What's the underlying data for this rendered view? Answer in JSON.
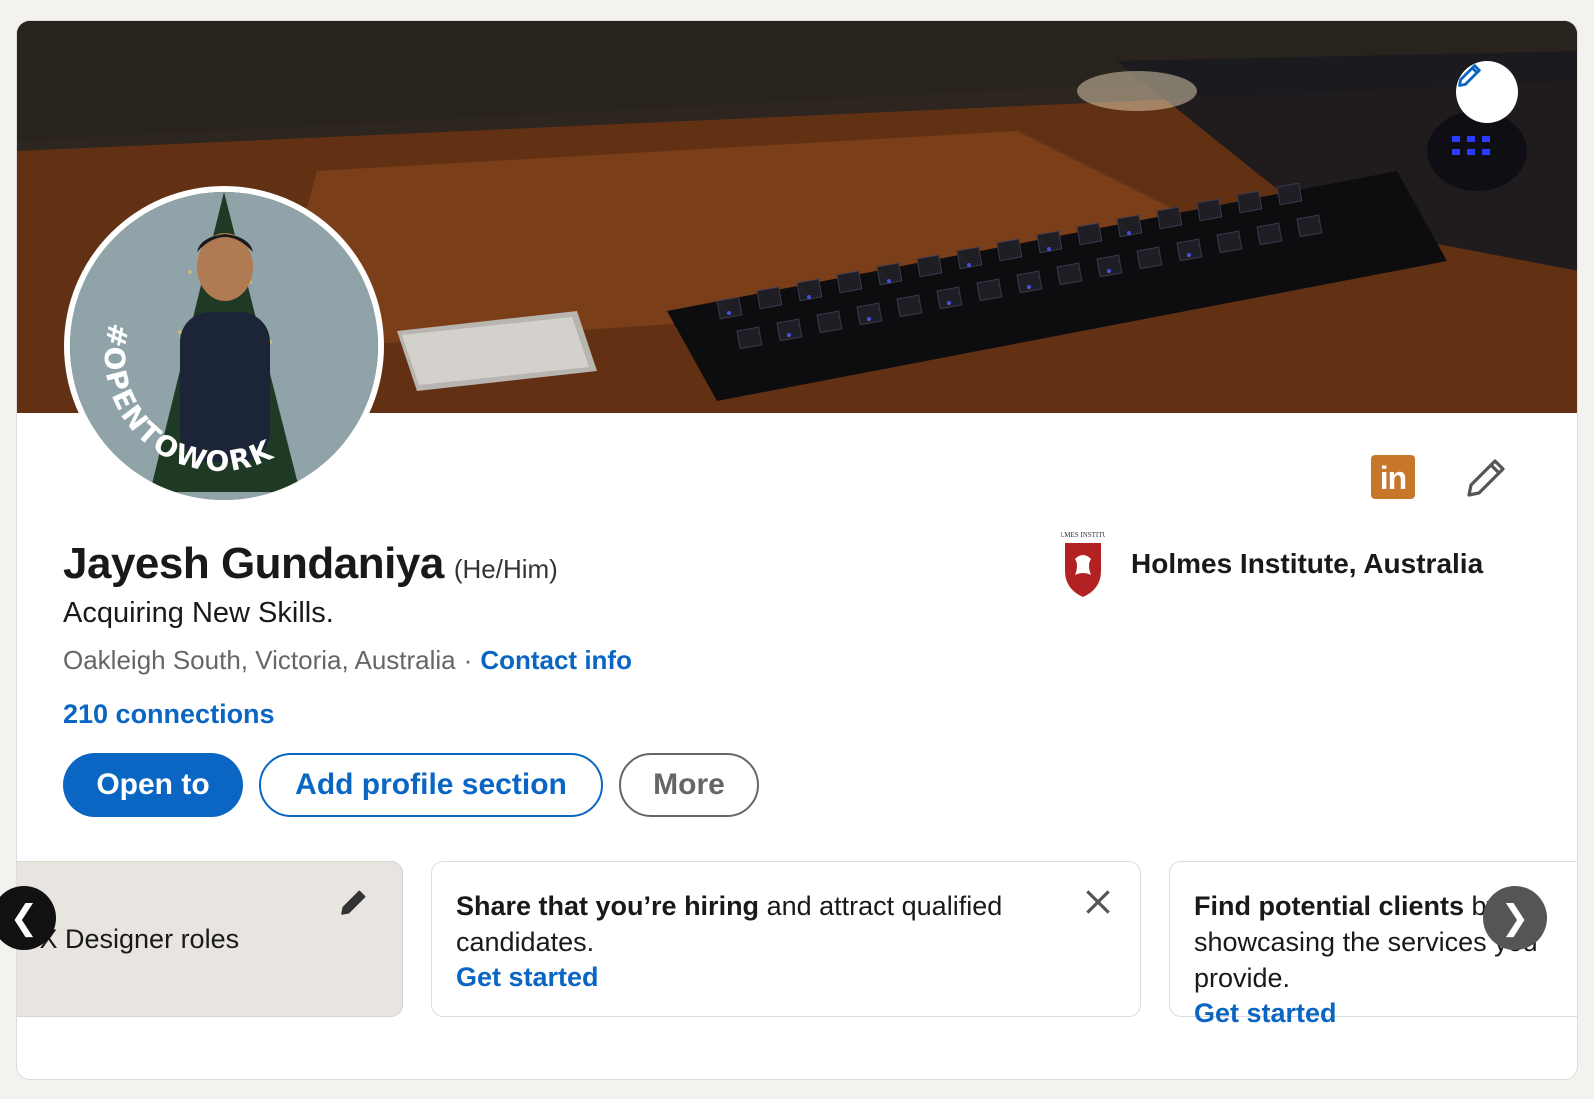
{
  "profile": {
    "name": "Jayesh Gundaniya",
    "pronouns": "(He/Him)",
    "headline": "Acquiring New Skills.",
    "location": "Oakleigh South, Victoria, Australia",
    "separator": "·",
    "contact_info_label": "Contact info",
    "connections_label": "210 connections",
    "open_to_work_frame": "#OPENTOWORK"
  },
  "education": {
    "school_name": "Holmes Institute, Australia",
    "logo_caption": "HOLMES INSTITUTE"
  },
  "icons": {
    "linkedin_badge": "in"
  },
  "actions": {
    "open_to_label": "Open to",
    "add_section_label": "Add profile section",
    "more_label": "More"
  },
  "carousel": {
    "first_card_label": "UX Designer roles",
    "hiring_bold": "Share that you’re hiring",
    "hiring_rest": " and attract qualified candidates.",
    "hiring_cta": "Get started",
    "clients_bold": "Find potential clients",
    "clients_rest": " by showcasing the services you provide.",
    "clients_cta": "Get started",
    "prev_glyph": "❮",
    "next_glyph": "❯"
  },
  "colors": {
    "brand_blue": "#0a66c2",
    "open_to_work_green": "#3d6b35",
    "linkedin_badge_orange": "#c8762a",
    "holmes_red": "#b22222"
  }
}
